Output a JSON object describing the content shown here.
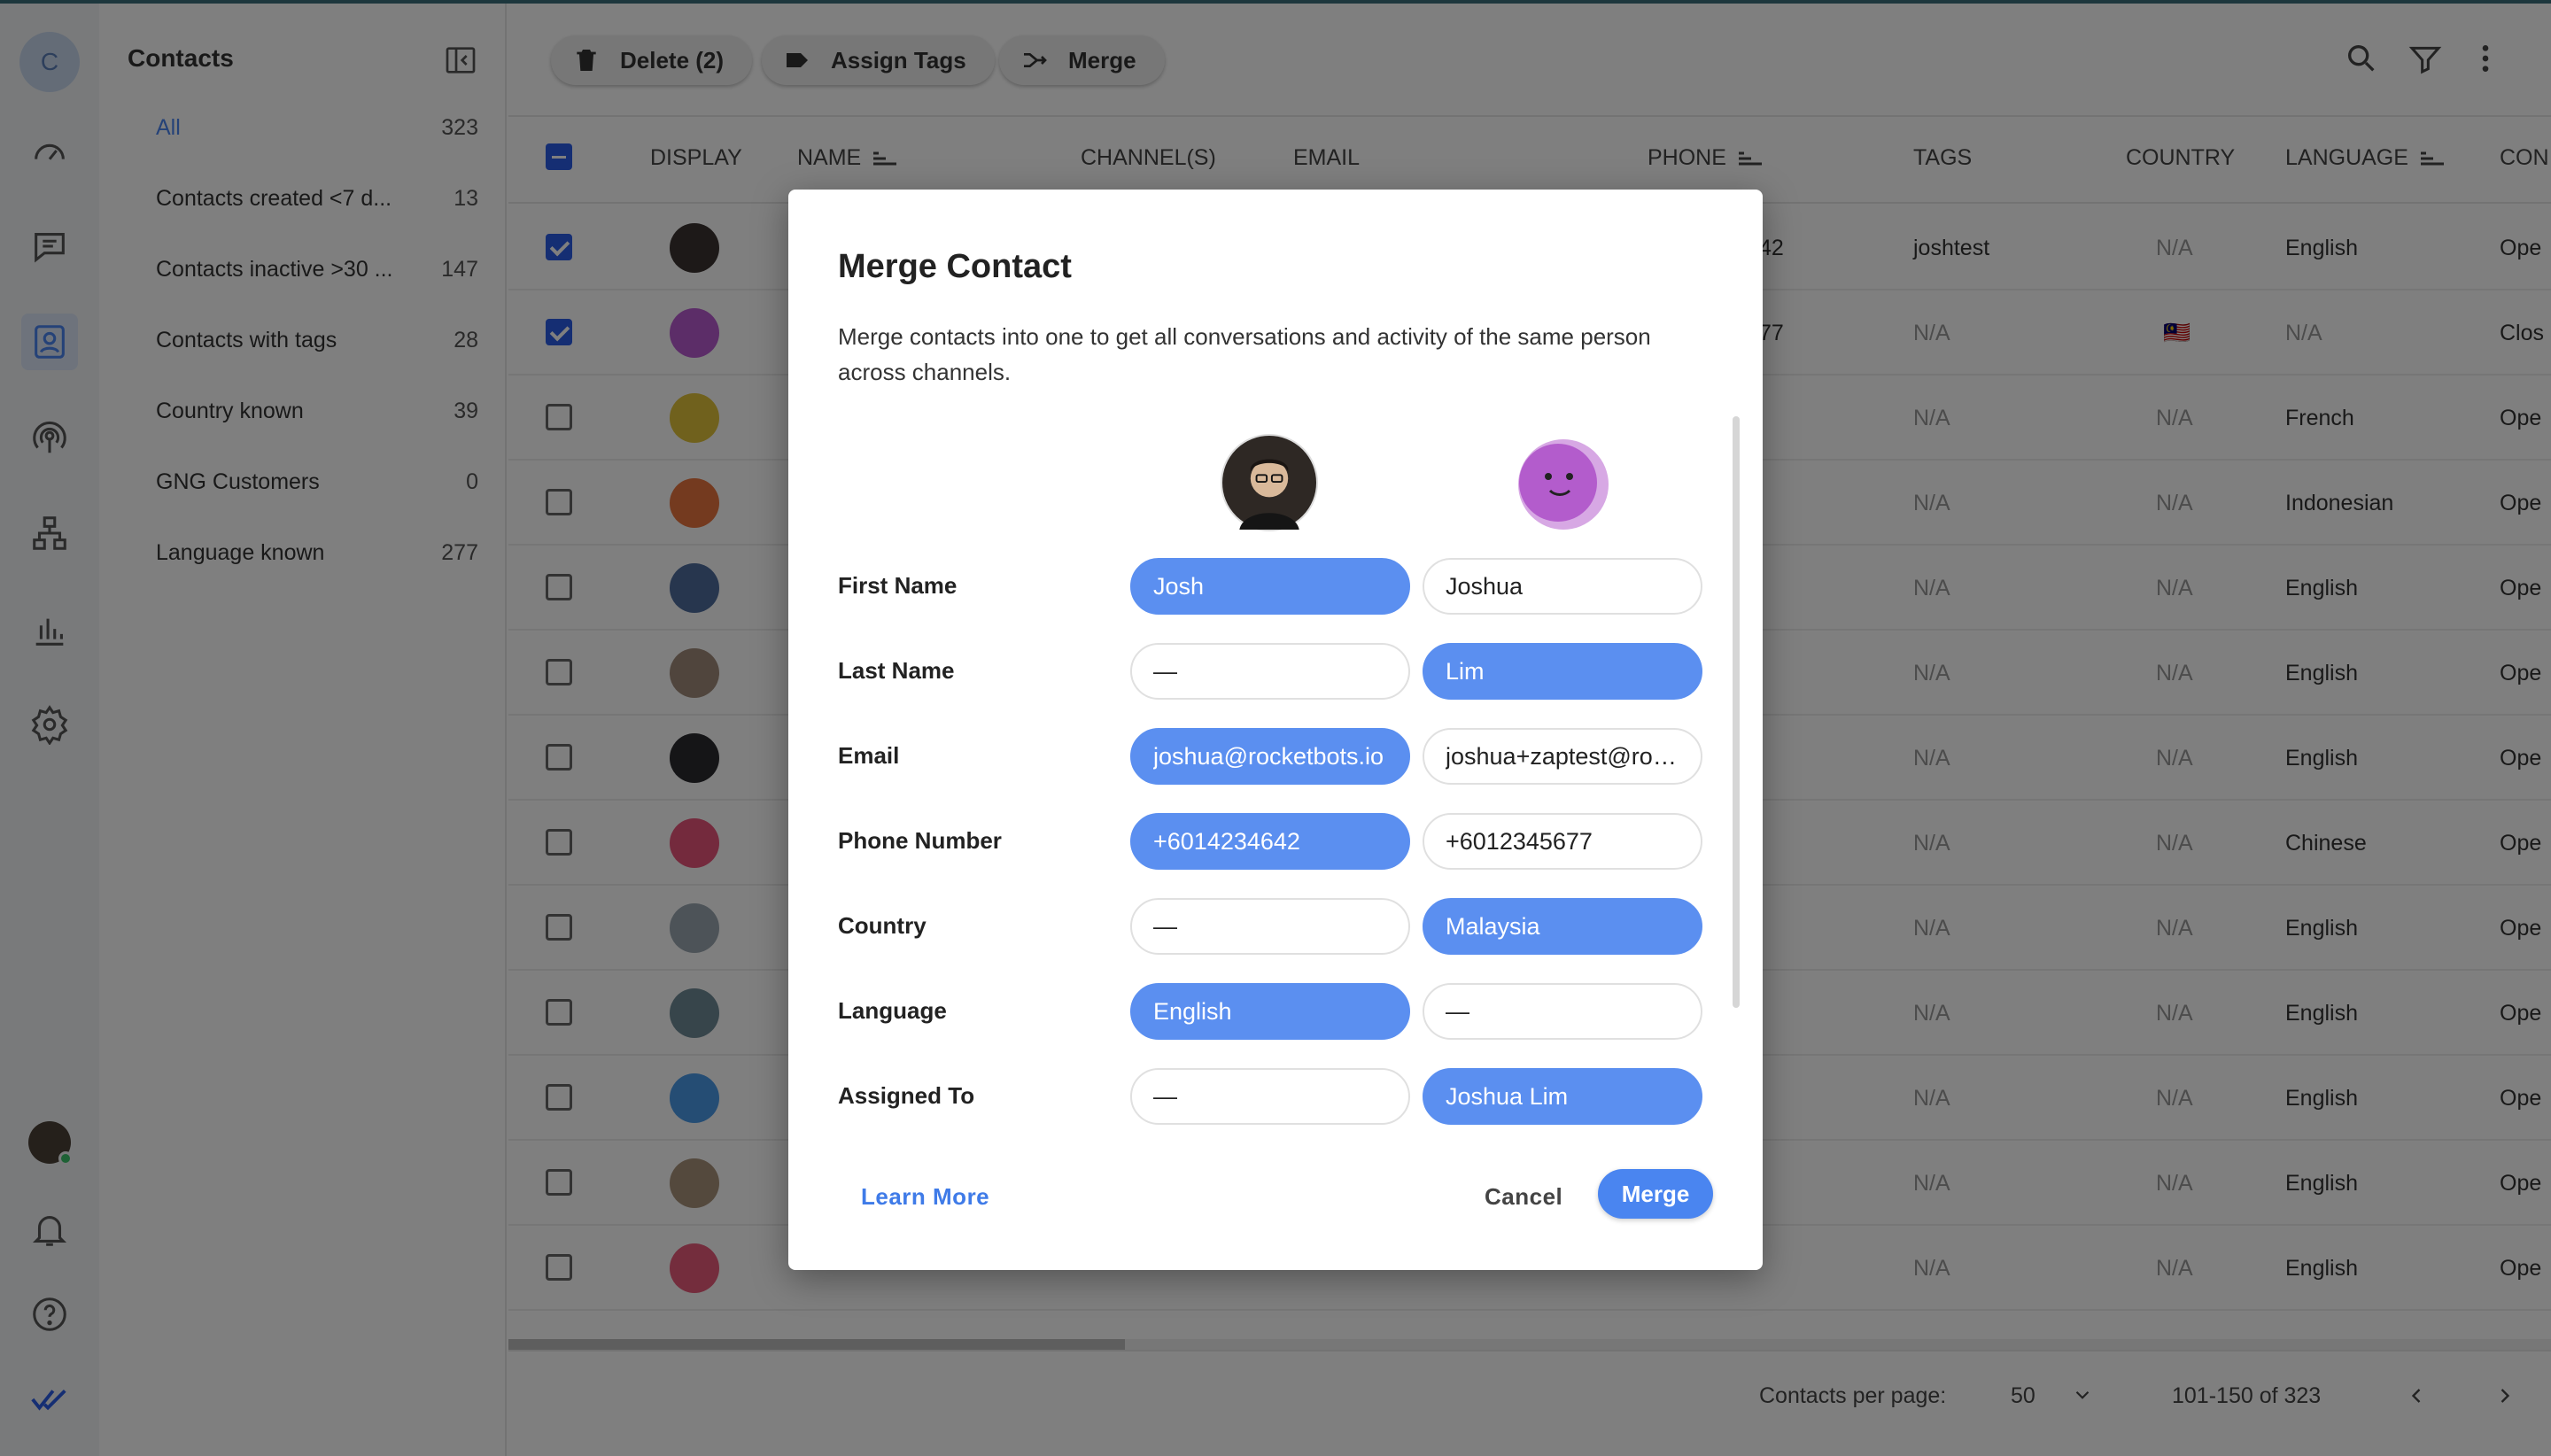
{
  "rail": {
    "workspace_initial": "C",
    "items": [
      "dashboard-icon",
      "messages-icon",
      "contacts-icon",
      "broadcast-icon",
      "workflows-icon",
      "reports-icon",
      "settings-icon"
    ],
    "bottom": [
      "user-avatar",
      "bell-icon",
      "help-icon",
      "brand-logo-icon"
    ]
  },
  "sidebar": {
    "title": "Contacts",
    "items": [
      {
        "label": "All",
        "count": "323",
        "active": true
      },
      {
        "label": "Contacts created <7 d...",
        "count": "13"
      },
      {
        "label": "Contacts inactive >30 ...",
        "count": "147"
      },
      {
        "label": "Contacts with tags",
        "count": "28"
      },
      {
        "label": "Country known",
        "count": "39"
      },
      {
        "label": "GNG Customers",
        "count": "0"
      },
      {
        "label": "Language known",
        "count": "277"
      }
    ]
  },
  "toolbar": {
    "delete_label": "Delete (2)",
    "assign_tags_label": "Assign Tags",
    "merge_label": "Merge"
  },
  "table": {
    "headers": {
      "display": "DISPLAY",
      "name": "NAME",
      "channels": "CHANNEL(S)",
      "email": "EMAIL",
      "phone": "PHONE",
      "tags": "TAGS",
      "country": "COUNTRY",
      "language": "LANGUAGE",
      "conversation": "CON"
    },
    "rows": [
      {
        "checked": true,
        "phone": "42",
        "tags": "joshtest",
        "country": "N/A",
        "language": "English",
        "status": "Ope",
        "avatar": "#3b3330"
      },
      {
        "checked": true,
        "phone": "77",
        "tags": "N/A",
        "country": "🇲🇾",
        "language": "N/A",
        "status": "Clos",
        "avatar": "#b85bd0"
      },
      {
        "checked": false,
        "phone": "",
        "tags": "N/A",
        "country": "N/A",
        "language": "French",
        "status": "Ope",
        "avatar": "#e0c33a"
      },
      {
        "checked": false,
        "phone": "",
        "tags": "N/A",
        "country": "N/A",
        "language": "Indonesian",
        "status": "Ope",
        "avatar": "#e8743f"
      },
      {
        "checked": false,
        "phone": "",
        "tags": "N/A",
        "country": "N/A",
        "language": "English",
        "status": "Ope",
        "avatar": "#4f6d9c"
      },
      {
        "checked": false,
        "phone": "",
        "tags": "N/A",
        "country": "N/A",
        "language": "English",
        "status": "Ope",
        "avatar": "#a08a7a"
      },
      {
        "checked": false,
        "phone": "",
        "tags": "N/A",
        "country": "N/A",
        "language": "English",
        "status": "Ope",
        "avatar": "#2a2a2e"
      },
      {
        "checked": false,
        "phone": "",
        "tags": "N/A",
        "country": "N/A",
        "language": "Chinese",
        "status": "Ope",
        "avatar": "#e8547a"
      },
      {
        "checked": false,
        "phone": "",
        "tags": "N/A",
        "country": "N/A",
        "language": "English",
        "status": "Ope",
        "avatar": "#9aa6b0"
      },
      {
        "checked": false,
        "phone": "",
        "tags": "N/A",
        "country": "N/A",
        "language": "English",
        "status": "Ope",
        "avatar": "#6f8a96"
      },
      {
        "checked": false,
        "phone": "",
        "tags": "N/A",
        "country": "N/A",
        "language": "English",
        "status": "Ope",
        "avatar": "#4a9ae8"
      },
      {
        "checked": false,
        "phone": "",
        "tags": "N/A",
        "country": "N/A",
        "language": "English",
        "status": "Ope",
        "avatar": "#a8927a"
      },
      {
        "checked": false,
        "phone": "",
        "tags": "N/A",
        "country": "N/A",
        "language": "English",
        "status": "Ope",
        "avatar": "#e85a7a"
      }
    ]
  },
  "footer": {
    "per_page_label": "Contacts per page:",
    "per_page_value": "50",
    "range": "101-150 of 323"
  },
  "dialog": {
    "title": "Merge Contact",
    "description": "Merge contacts into one to get all conversations and activity of the same person across channels.",
    "fields": [
      {
        "label": "First Name",
        "left": "Josh",
        "right": "Joshua",
        "selected": "left"
      },
      {
        "label": "Last Name",
        "left": "—",
        "right": "Lim",
        "selected": "right"
      },
      {
        "label": "Email",
        "left": "joshua@rocketbots.io",
        "right": "joshua+zaptest@rocketbots.io",
        "selected": "left"
      },
      {
        "label": "Phone Number",
        "left": "+6014234642",
        "right": "+6012345677",
        "selected": "left"
      },
      {
        "label": "Country",
        "left": "—",
        "right": "Malaysia",
        "selected": "right"
      },
      {
        "label": "Language",
        "left": "English",
        "right": "—",
        "selected": "left"
      },
      {
        "label": "Assigned To",
        "left": "—",
        "right": "Joshua Lim",
        "selected": "right"
      }
    ],
    "learn_more": "Learn More",
    "cancel": "Cancel",
    "merge": "Merge",
    "colors": {
      "selected": "#5b8ff0",
      "accent": "#4a85f0"
    }
  }
}
